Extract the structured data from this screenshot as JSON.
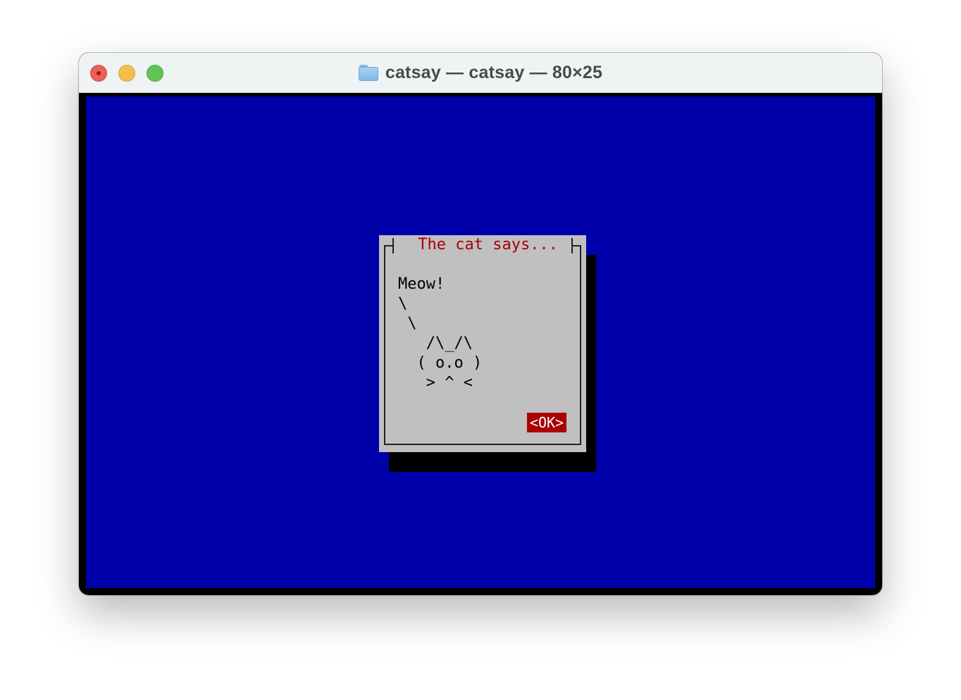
{
  "window": {
    "title": "catsay — catsay — 80×25",
    "controls": {
      "close": "close-button",
      "minimize": "minimize-button",
      "zoom": "zoom-button"
    },
    "title_icon": "folder-icon"
  },
  "terminal": {
    "background_color": "#0000aa",
    "dialog": {
      "title": " The cat says... ",
      "body_lines": [
        "Meow!",
        "\\",
        " \\",
        "   /\\_/\\",
        "  ( o.o )",
        "   > ^ <"
      ],
      "ok_label": "<OK>",
      "colors": {
        "background": "#c0c0c0",
        "title": "#aa0000",
        "button": "#aa0000",
        "shadow": "#000000"
      }
    }
  }
}
